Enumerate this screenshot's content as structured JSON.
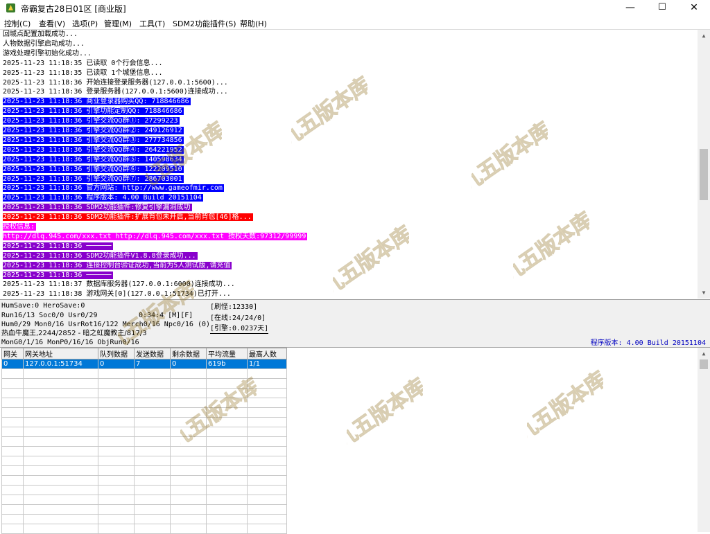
{
  "window": {
    "title": "帝霸复古28日01区 [商业版]",
    "minimize": "—",
    "maximize": "☐",
    "close": "✕"
  },
  "menu": [
    "控制(C)",
    "查看(V)",
    "选项(P)",
    "管理(M)",
    "工具(T)",
    "SDM2功能插件(S)",
    "帮助(H)"
  ],
  "log": [
    {
      "t": "回城点配置加载成功...",
      "bg": ""
    },
    {
      "t": "人物数据引擎启动成功...",
      "bg": ""
    },
    {
      "t": "游戏处理引擎初始化成功...",
      "bg": ""
    },
    {
      "t": "2025-11-23 11:18:35 已读取 0个行会信息...",
      "bg": ""
    },
    {
      "t": "2025-11-23 11:18:35 已读取 1个城堡信息...",
      "bg": ""
    },
    {
      "t": "2025-11-23 11:18:36 开始连接登录服务器(127.0.0.1:5600)...",
      "bg": ""
    },
    {
      "t": "2025-11-23 11:18:36 登录服务器(127.0.0.1:5600)连接成功...",
      "bg": ""
    },
    {
      "t": "2025-11-23 11:18:36 商业登录器购买QQ: 718846686",
      "bg": "#0000ff"
    },
    {
      "t": "2025-11-23 11:18:36 引擎功能定制QQ: 718846686",
      "bg": "#0000ff"
    },
    {
      "t": "2025-11-23 11:18:36 引擎交流QQ群①: 27299223",
      "bg": "#0000ff"
    },
    {
      "t": "2025-11-23 11:18:36 引擎交流QQ群②: 249126912",
      "bg": "#0000ff"
    },
    {
      "t": "2025-11-23 11:18:36 引擎交流QQ群③: 277734856",
      "bg": "#0000ff"
    },
    {
      "t": "2025-11-23 11:18:36 引擎交流QQ群④: 264221952",
      "bg": "#0000ff"
    },
    {
      "t": "2025-11-23 11:18:36 引擎交流QQ群⑤: 140598634",
      "bg": "#0000ff"
    },
    {
      "t": "2025-11-23 11:18:36 引擎交流QQ群⑥: 122209510",
      "bg": "#0000ff"
    },
    {
      "t": "2025-11-23 11:18:36 引擎交流QQ群⑦: 286703001",
      "bg": "#0000ff"
    },
    {
      "t": "2025-11-23 11:18:36 官方网站: http://www.gameofmir.com",
      "bg": "#0000ff"
    },
    {
      "t": "2025-11-23 11:18:36 程序版本: 4.00 Build 20151104",
      "bg": "#0000ff"
    },
    {
      "t": "2025-11-23 11:18:36 SDM2功能插件:修复引擎漏洞成功",
      "bg": "#8800cc"
    },
    {
      "t": "2025-11-23 11:18:36 SDM2功能插件:扩展背包未开启,当前背包[46]格...",
      "bg": "#ff0000"
    },
    {
      "t": "授权信息:",
      "bg": "#ff00ff"
    },
    {
      "t": "http://dlq.945.com/xxx.txt http://dlq.945.com/xxx.txt 授权天数:97312/99999",
      "bg": "#ff00ff"
    },
    {
      "t": "2025-11-23 11:18:36 ──────",
      "bg": "#8800cc"
    },
    {
      "t": "2025-11-23 11:18:36 SDM2功能插件V1.8.8登录成功...",
      "bg": "#8800cc"
    },
    {
      "t": "2025-11-23 11:18:36 连接控制台验证成功,当前为5人测试版,请充值",
      "bg": "#8800cc"
    },
    {
      "t": "2025-11-23 11:18:36 ──────",
      "bg": "#8800cc"
    },
    {
      "t": "2025-11-23 11:18:37 数据库服务器(127.0.0.1:6000)连接成功...",
      "bg": ""
    },
    {
      "t": "2025-11-23 11:18:38 游戏网关[0](127.0.0.1:51734)已打开...",
      "bg": ""
    }
  ],
  "status": {
    "line1": "HumSave:0 HeroSave:0",
    "line2": "Run16/13 Soc0/0 Usr0/29",
    "timer": "0:34:4 [M][F]",
    "line3": "Hum0/29 Mon0/16 UsrRot16/122 Merch0/16 Npc0/16 (0)",
    "line4": "热血牛魔王,2244/2852 - 暗之虹魔教主/817/3",
    "line5": "MonG0/1/16 MonP0/16/16 ObjRun0/16",
    "refresh": "[刷怪:12330]",
    "online": "[在线:24/24/0]",
    "engine": "[引擎:0.0237天]",
    "version": "程序版本: 4.00 Build 20151104"
  },
  "gateway_table": {
    "headers": [
      "网关",
      "网关地址",
      "队列数据",
      "发送数据",
      "剩余数据",
      "平均流量",
      "最高人数"
    ],
    "rows": [
      [
        "0",
        "127.0.0.1:51734",
        "0",
        "7",
        "0",
        "619b",
        "1/1"
      ]
    ]
  },
  "watermark_text": "九五版本库",
  "colors": {
    "selection": "#0078d7"
  }
}
